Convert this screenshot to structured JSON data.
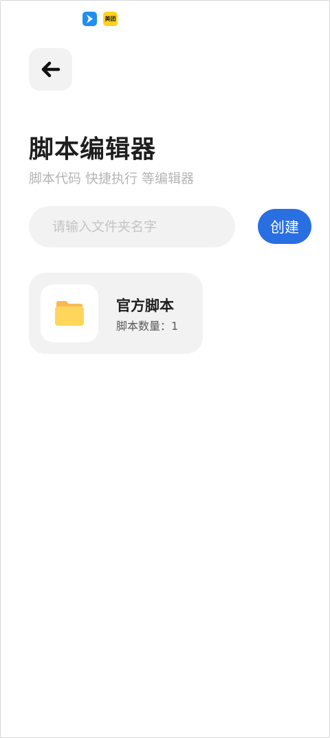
{
  "status_bar": {
    "icons": [
      {
        "name": "navigation-app-icon",
        "color": "#1f8ff0"
      },
      {
        "name": "meituan-app-icon",
        "label": "美团",
        "color": "#ffd21e"
      }
    ]
  },
  "header": {
    "back_icon": "arrow-left-icon",
    "title": "脚本编辑器",
    "subtitle": "脚本代码 快捷执行 等编辑器"
  },
  "folder_input": {
    "placeholder": "请输入文件夹名字",
    "value": ""
  },
  "create_button": {
    "label": "创建",
    "color": "#2a6fe1"
  },
  "folders": [
    {
      "icon": "folder-icon",
      "icon_color": "#ffd65a",
      "name": "官方脚本",
      "count_text": "脚本数量：1"
    }
  ]
}
